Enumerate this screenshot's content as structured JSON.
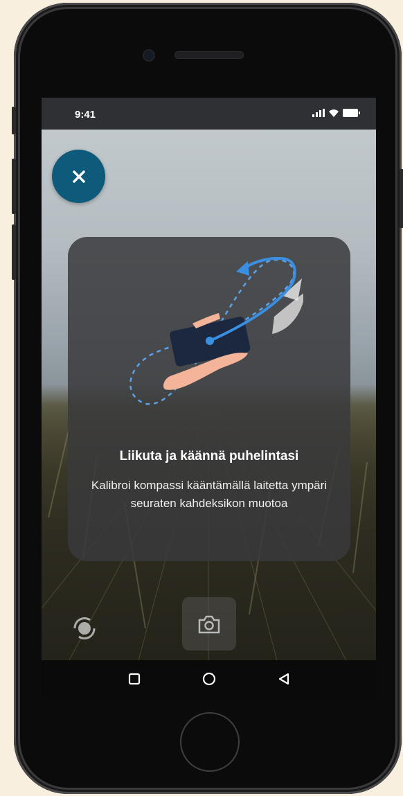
{
  "status_bar": {
    "time": "9:41"
  },
  "close_button": {
    "icon": "close-icon"
  },
  "calibration_card": {
    "title": "Liikuta ja käännä puhelintasi",
    "body": "Kalibroi kompassi kääntämällä laitetta ympäri seuraten kahdeksikon muotoa"
  },
  "bottom_controls": {
    "switch_icon": "camera-switch-icon",
    "shutter_icon": "camera-icon"
  },
  "nav_bar": {
    "items": [
      "square-icon",
      "circle-icon",
      "back-triangle-icon"
    ]
  },
  "colors": {
    "accent": "#0d5a7a",
    "arrow": "#3b8fe0",
    "card": "#3a3a3c"
  }
}
